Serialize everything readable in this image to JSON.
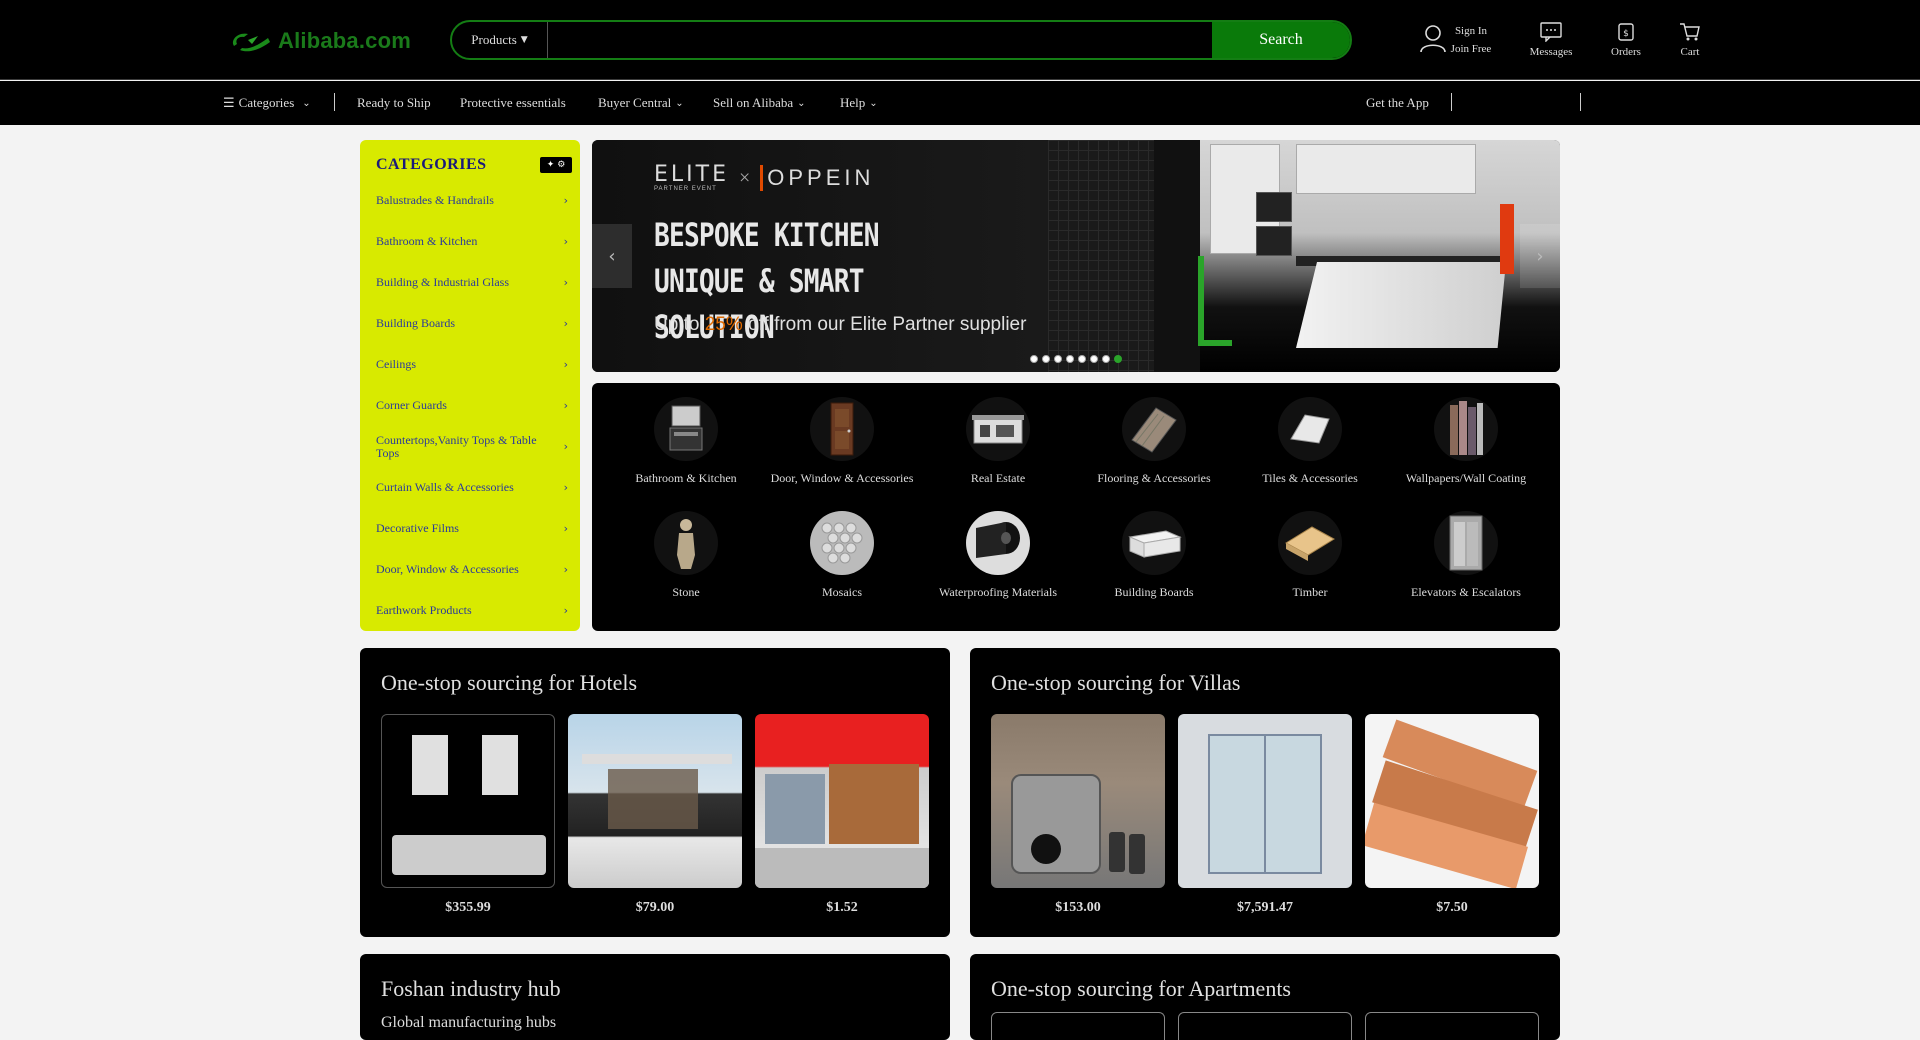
{
  "header": {
    "logo_text": "Alibaba.com",
    "search": {
      "category": "Products",
      "placeholder": "",
      "button": "Search"
    },
    "signin": {
      "line1": "Sign In",
      "line2": "Join Free"
    },
    "messages": "Messages",
    "orders": "Orders",
    "cart": "Cart"
  },
  "nav": {
    "categories": "Categories",
    "items": [
      "Ready to Ship",
      "Protective essentials",
      "Buyer Central",
      "Sell on Alibaba",
      "Help"
    ],
    "get_app": "Get the App"
  },
  "categories": {
    "title": "CATEGORIES",
    "items": [
      "Balustrades & Handrails",
      "Bathroom & Kitchen",
      "Building & Industrial Glass",
      "Building Boards",
      "Ceilings",
      "Corner Guards",
      "Countertops,Vanity Tops & Table Tops",
      "Curtain Walls & Accessories",
      "Decorative Films",
      "Door, Window & Accessories",
      "Earthwork Products"
    ]
  },
  "banner": {
    "partner": "ELITE",
    "partner_sub": "PARTNER EVENT",
    "times": "×",
    "brand": "OPPEIN",
    "headline_1": "BESPOKE KITCHEN",
    "headline_2": "UNIQUE & SMART SOLUTION",
    "sub_prefix": "Up to ",
    "sub_pct": "25%",
    "sub_suffix": " off from our Elite Partner supplier",
    "slides": 8,
    "active_slide": 8
  },
  "icon_categories": [
    {
      "label": "Bathroom & Kitchen",
      "icon": "vanity-cabinet-icon"
    },
    {
      "label": "Door, Window & Accessories",
      "icon": "door-icon"
    },
    {
      "label": "Real Estate",
      "icon": "prefab-house-icon"
    },
    {
      "label": "Flooring & Accessories",
      "icon": "floor-planks-icon"
    },
    {
      "label": "Tiles & Accessories",
      "icon": "tile-icon"
    },
    {
      "label": "Wallpapers/Wall Coating",
      "icon": "wallpaper-rolls-icon"
    },
    {
      "label": "Stone",
      "icon": "stone-statue-icon"
    },
    {
      "label": "Mosaics",
      "icon": "mosaic-icon"
    },
    {
      "label": "Waterproofing Materials",
      "icon": "membrane-roll-icon"
    },
    {
      "label": "Building Boards",
      "icon": "board-stack-icon"
    },
    {
      "label": "Timber",
      "icon": "timber-icon"
    },
    {
      "label": "Elevators & Escalators",
      "icon": "elevator-icon"
    }
  ],
  "cards": {
    "hotels": {
      "title": "One-stop sourcing for Hotels",
      "products": [
        {
          "price": "$355.99",
          "image": "bathroom-vanity-image"
        },
        {
          "price": "$79.00",
          "image": "glass-villa-image"
        },
        {
          "price": "$1.52",
          "image": "wood-cladding-house-image"
        }
      ]
    },
    "villas": {
      "title": "One-stop sourcing for Villas",
      "products": [
        {
          "price": "$153.00",
          "image": "gate-opener-image"
        },
        {
          "price": "$7,591.47",
          "image": "glass-elevator-image"
        },
        {
          "price": "$7.50",
          "image": "wood-veneer-image"
        }
      ]
    },
    "foshan": {
      "title": "Foshan industry hub",
      "subtitle": "Global manufacturing hubs"
    },
    "apartments": {
      "title": "One-stop sourcing for Apartments"
    }
  },
  "colors": {
    "accent_green": "#0a7a0a",
    "category_panel": "#d8ea00",
    "header": "#000000"
  }
}
